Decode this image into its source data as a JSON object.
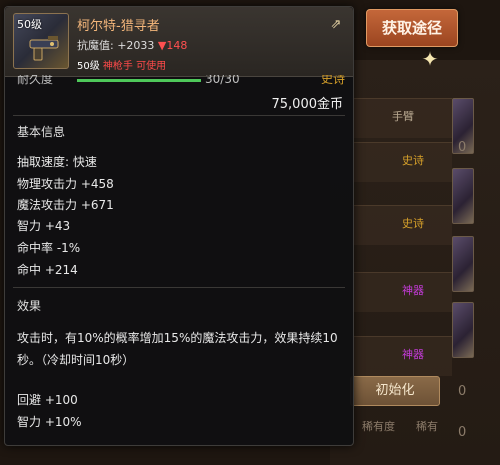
{
  "background": {
    "tags": [
      "手臂",
      "史诗",
      "史诗",
      "神器",
      "神器"
    ],
    "reset_button": "初始化",
    "bottom_labels": [
      "稀有度",
      "稀有"
    ],
    "digits": [
      "0",
      "0",
      "0"
    ]
  },
  "get_source_button": "获取途径",
  "tooltip": {
    "icon_level": "50级",
    "item_name": "柯尔特-猎寻者",
    "resist_label": "抗魔值: +2033",
    "resist_diff": "▼148",
    "req_level": "50级",
    "req_class": "神枪手 可使用",
    "durability_label": "耐久度",
    "durability_value": "30/30",
    "durability_fraction": 1.0,
    "rarity": "史诗",
    "price": "75,000金币",
    "basic_info_title": "基本信息",
    "stats": [
      "抽取速度: 快速",
      "物理攻击力 +458",
      "魔法攻击力 +671",
      "智力 +43",
      "命中率 -1%",
      "命中 +214"
    ],
    "effect_title": "效果",
    "effect_desc": "攻击时，有10%的概率增加15%的魔法攻击力，效果持续10秒。（冷却时间10秒）",
    "bonus_stats": [
      "回避 +100",
      "智力 +10%"
    ]
  },
  "colors": {
    "item_name": "#f2b57a",
    "down_arrow": "#ff5050",
    "class_requirement": "#ff4a4a",
    "rarity_epic": "#d6a02a",
    "rarity_artifact": "#c23bd6",
    "button_orange": "#c4673a"
  }
}
